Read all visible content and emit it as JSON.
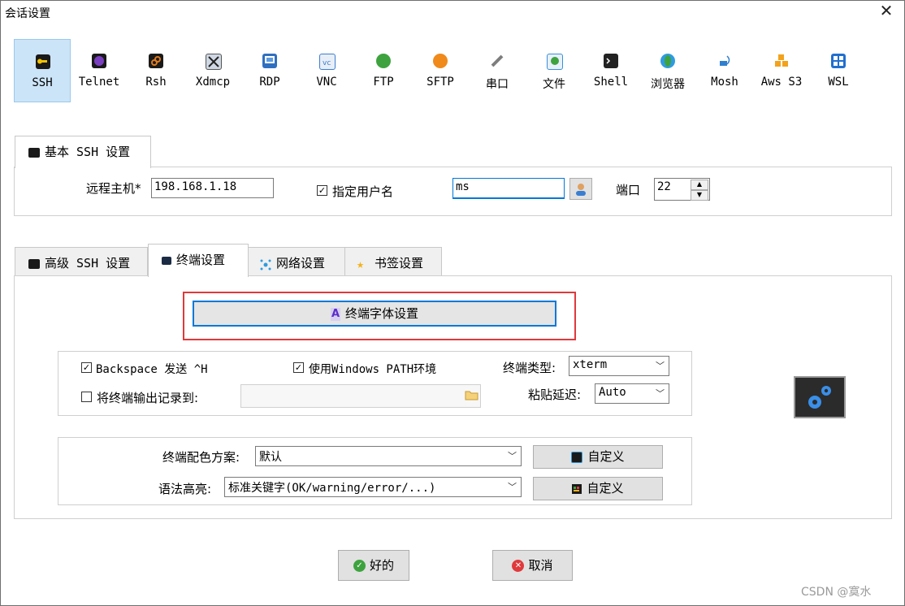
{
  "window": {
    "title": "会话设置",
    "close_label": "✕"
  },
  "session_types": [
    {
      "label": "SSH",
      "icon": "key-icon",
      "color": "#f2c200",
      "selected": true
    },
    {
      "label": "Telnet",
      "icon": "telnet-icon",
      "color": "#7a3fc0"
    },
    {
      "label": "Rsh",
      "icon": "rsh-icon",
      "color": "#e07a1b"
    },
    {
      "label": "Xdmcp",
      "icon": "xdmcp-icon",
      "color": "#444444"
    },
    {
      "label": "RDP",
      "icon": "rdp-icon",
      "color": "#2f6fc0"
    },
    {
      "label": "VNC",
      "icon": "vnc-icon",
      "color": "#3a7ed1"
    },
    {
      "label": "FTP",
      "icon": "ftp-icon",
      "color": "#3ea33e"
    },
    {
      "label": "SFTP",
      "icon": "sftp-icon",
      "color": "#f08a1a"
    },
    {
      "label": "串口",
      "icon": "serial-icon",
      "color": "#7d7d7d"
    },
    {
      "label": "文件",
      "icon": "file-icon",
      "color": "#3a8fd8"
    },
    {
      "label": "Shell",
      "icon": "shell-icon",
      "color": "#222222"
    },
    {
      "label": "浏览器",
      "icon": "browser-icon",
      "color": "#2e9be0"
    },
    {
      "label": "Mosh",
      "icon": "mosh-icon",
      "color": "#2f7fd0"
    },
    {
      "label": "Aws S3",
      "icon": "aws-icon",
      "color": "#f3a21c"
    },
    {
      "label": "WSL",
      "icon": "wsl-icon",
      "color": "#1f6fd0"
    }
  ],
  "basic_tab": {
    "label": "基本 SSH 设置"
  },
  "basic": {
    "remote_host_label": "远程主机*",
    "remote_host_value": "198.168.1.18",
    "specify_user_label": "指定用户名",
    "specify_user_checked": "✓",
    "username_value": "ms",
    "port_label": "端口",
    "port_value": "22"
  },
  "tabs": [
    {
      "label": "高级 SSH 设置",
      "icon": "key-icon"
    },
    {
      "label": "终端设置",
      "icon": "terminal-icon",
      "active": true
    },
    {
      "label": "网络设置",
      "icon": "network-icon"
    },
    {
      "label": "书签设置",
      "icon": "star-icon"
    }
  ],
  "terminal": {
    "font_button_label": "终端字体设置",
    "backspace_label": "Backspace 发送 ^H",
    "backspace_checked": "✓",
    "use_windows_path_label": "使用Windows PATH环境",
    "use_windows_path_checked": "✓",
    "log_output_label": "将终端输出记录到:",
    "log_output_checked": "",
    "log_path_value": "",
    "term_type_label": "终端类型:",
    "term_type_value": "xterm",
    "paste_delay_label": "粘贴延迟:",
    "paste_delay_value": "Auto",
    "color_scheme_label": "终端配色方案:",
    "color_scheme_value": "默认",
    "syntax_label": "语法高亮:",
    "syntax_value": "标准关键字(OK/warning/error/...)",
    "customize_label": "自定义",
    "customize2_label": "自定义"
  },
  "footer": {
    "ok_label": "好的",
    "cancel_label": "取消"
  },
  "watermark": "CSDN @寞水",
  "colors": {
    "highlight_box": "#e0393b",
    "selected_bg": "#cce4f7"
  }
}
